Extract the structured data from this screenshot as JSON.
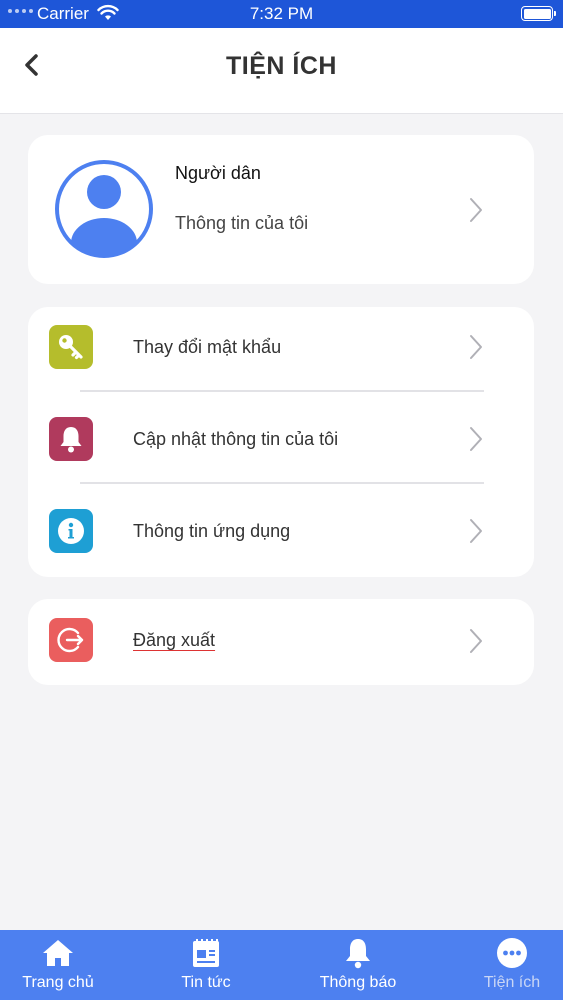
{
  "status_bar": {
    "carrier": "Carrier",
    "time": "7:32 PM"
  },
  "header": {
    "title": "TIỆN ÍCH",
    "back_icon": "chevron-left-icon"
  },
  "profile": {
    "name": "Người dân",
    "subtitle": "Thông tin của tôi",
    "avatar_color": "#4d80f0"
  },
  "menu": {
    "items": [
      {
        "label": "Thay đổi mật khẩu",
        "icon": "key-icon",
        "color": "#b5bd2c"
      },
      {
        "label": "Cập nhật thông tin của tôi",
        "icon": "bell-icon",
        "color": "#b03a5d"
      },
      {
        "label": "Thông tin ứng dụng",
        "icon": "info-icon",
        "color": "#1e9fd4"
      }
    ]
  },
  "logout": {
    "label": "Đăng xuất",
    "icon": "logout-icon",
    "color": "#ea5e5e"
  },
  "tabs": [
    {
      "label": "Trang chủ",
      "icon": "home-icon",
      "active": true
    },
    {
      "label": "Tin tức",
      "icon": "news-icon",
      "active": true
    },
    {
      "label": "Thông báo",
      "icon": "bell-icon",
      "active": true
    },
    {
      "label": "Tiện ích",
      "icon": "more-icon",
      "active": false
    }
  ],
  "colors": {
    "primary": "#1e56d8",
    "tab_bar": "#4d80f0",
    "background": "#f4f4f6"
  }
}
